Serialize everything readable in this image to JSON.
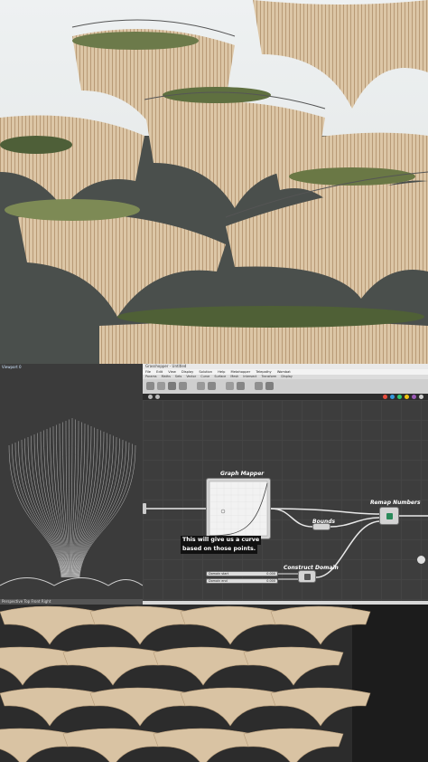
{
  "viewport": {
    "title": "Viewport 0",
    "status": "Perspective  Top  Front  Right"
  },
  "grasshopper": {
    "window_title": "Grasshopper - Untitled",
    "menu": [
      "File",
      "Edit",
      "View",
      "Display",
      "Solution",
      "Help",
      "Metahopper",
      "Telepathy",
      "Wombat"
    ],
    "tabs": [
      "Params",
      "Maths",
      "Sets",
      "Vector",
      "Curve",
      "Surface",
      "Mesh",
      "Intersect",
      "Transform",
      "Display"
    ],
    "nodes": {
      "graph_mapper": "Graph Mapper",
      "bounds": "Bounds",
      "remap_numbers": "Remap Numbers",
      "construct_domain": "Construct Domain"
    },
    "sliders": [
      {
        "label": "Domain start",
        "value": "0.000"
      },
      {
        "label": "Domain end",
        "value": "0.000"
      }
    ],
    "subtitle_lines": [
      "This will give us a curve",
      "based on those points."
    ]
  },
  "colors": {
    "canvas": "#3d3d3d",
    "node_body": "#d4d4d4",
    "wire": "#e8e8e8",
    "wood": "#d9c3a3"
  }
}
